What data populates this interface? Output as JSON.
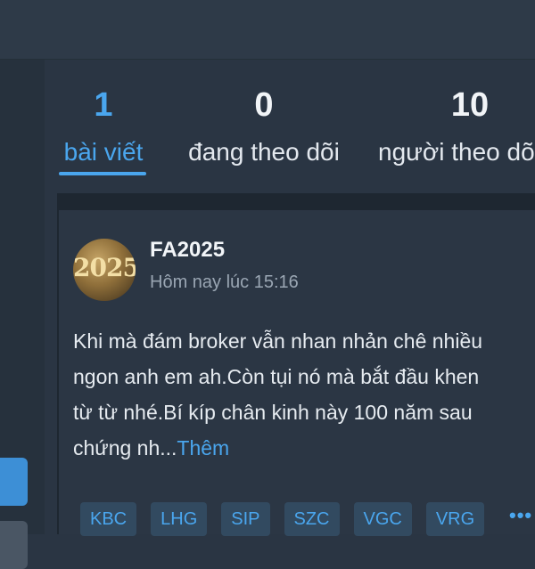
{
  "stats": [
    {
      "value": "1",
      "label": "bài viết"
    },
    {
      "value": "0",
      "label": "đang theo dõi"
    },
    {
      "value": "10",
      "label": "người theo dõi"
    }
  ],
  "post": {
    "author": "FA2025",
    "avatar_text": "2025",
    "time": "Hôm nay lúc 15:16",
    "lines": [
      "Khi mà đám broker vẫn nhan nhản chê nhiều",
      "ngon anh em ah.Còn tụi nó mà bắt đầu khen",
      "từ từ nhé.Bí kíp chân kinh này 100 năm sau",
      "chứng nh..."
    ],
    "more_label": "Thêm",
    "tags": [
      "KBC",
      "LHG",
      "SIP",
      "SZC",
      "VGC",
      "VRG"
    ],
    "more_tags": "•••"
  },
  "colors": {
    "accent": "#4aa6ee",
    "background": "#2a3543",
    "card": "#2b3644"
  }
}
